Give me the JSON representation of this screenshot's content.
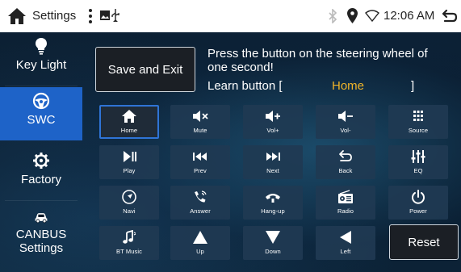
{
  "statusbar": {
    "title": "Settings",
    "time": "12:06 AM"
  },
  "sidebar": {
    "items": [
      {
        "label": "Key Light",
        "icon": "bulb-icon"
      },
      {
        "label": "SWC",
        "icon": "steering-wheel-icon",
        "active": true
      },
      {
        "label": "Factory",
        "icon": "gear-icon"
      },
      {
        "label": "CANBUS Settings",
        "icon": "car-icon"
      }
    ]
  },
  "main": {
    "save_label": "Save and Exit",
    "prompt": "Press the button on the steering wheel of one second!",
    "learn_label": "Learn button [",
    "learn_value": "Home",
    "learn_close": "]",
    "reset_label": "Reset",
    "accent_color": "#f0b429",
    "selected_color": "#2f74d6"
  },
  "keys": [
    {
      "label": "Home",
      "icon": "home-icon"
    },
    {
      "label": "Mute",
      "icon": "mute-icon"
    },
    {
      "label": "Vol+",
      "icon": "volume-up-icon"
    },
    {
      "label": "Vol-",
      "icon": "volume-down-icon"
    },
    {
      "label": "Source",
      "icon": "grid-icon"
    },
    {
      "label": "Play",
      "icon": "play-pause-icon"
    },
    {
      "label": "Prev",
      "icon": "previous-icon"
    },
    {
      "label": "Next",
      "icon": "next-icon"
    },
    {
      "label": "Back",
      "icon": "back-icon"
    },
    {
      "label": "EQ",
      "icon": "equalizer-icon"
    },
    {
      "label": "Navi",
      "icon": "navigation-icon"
    },
    {
      "label": "Answer",
      "icon": "phone-answer-icon"
    },
    {
      "label": "Hang-up",
      "icon": "phone-hangup-icon"
    },
    {
      "label": "Radio",
      "icon": "radio-icon"
    },
    {
      "label": "Power",
      "icon": "power-icon"
    },
    {
      "label": "BT Music",
      "icon": "music-icon"
    },
    {
      "label": "Up",
      "icon": "arrow-up-icon"
    },
    {
      "label": "Down",
      "icon": "arrow-down-icon"
    },
    {
      "label": "Left",
      "icon": "arrow-left-icon"
    }
  ]
}
